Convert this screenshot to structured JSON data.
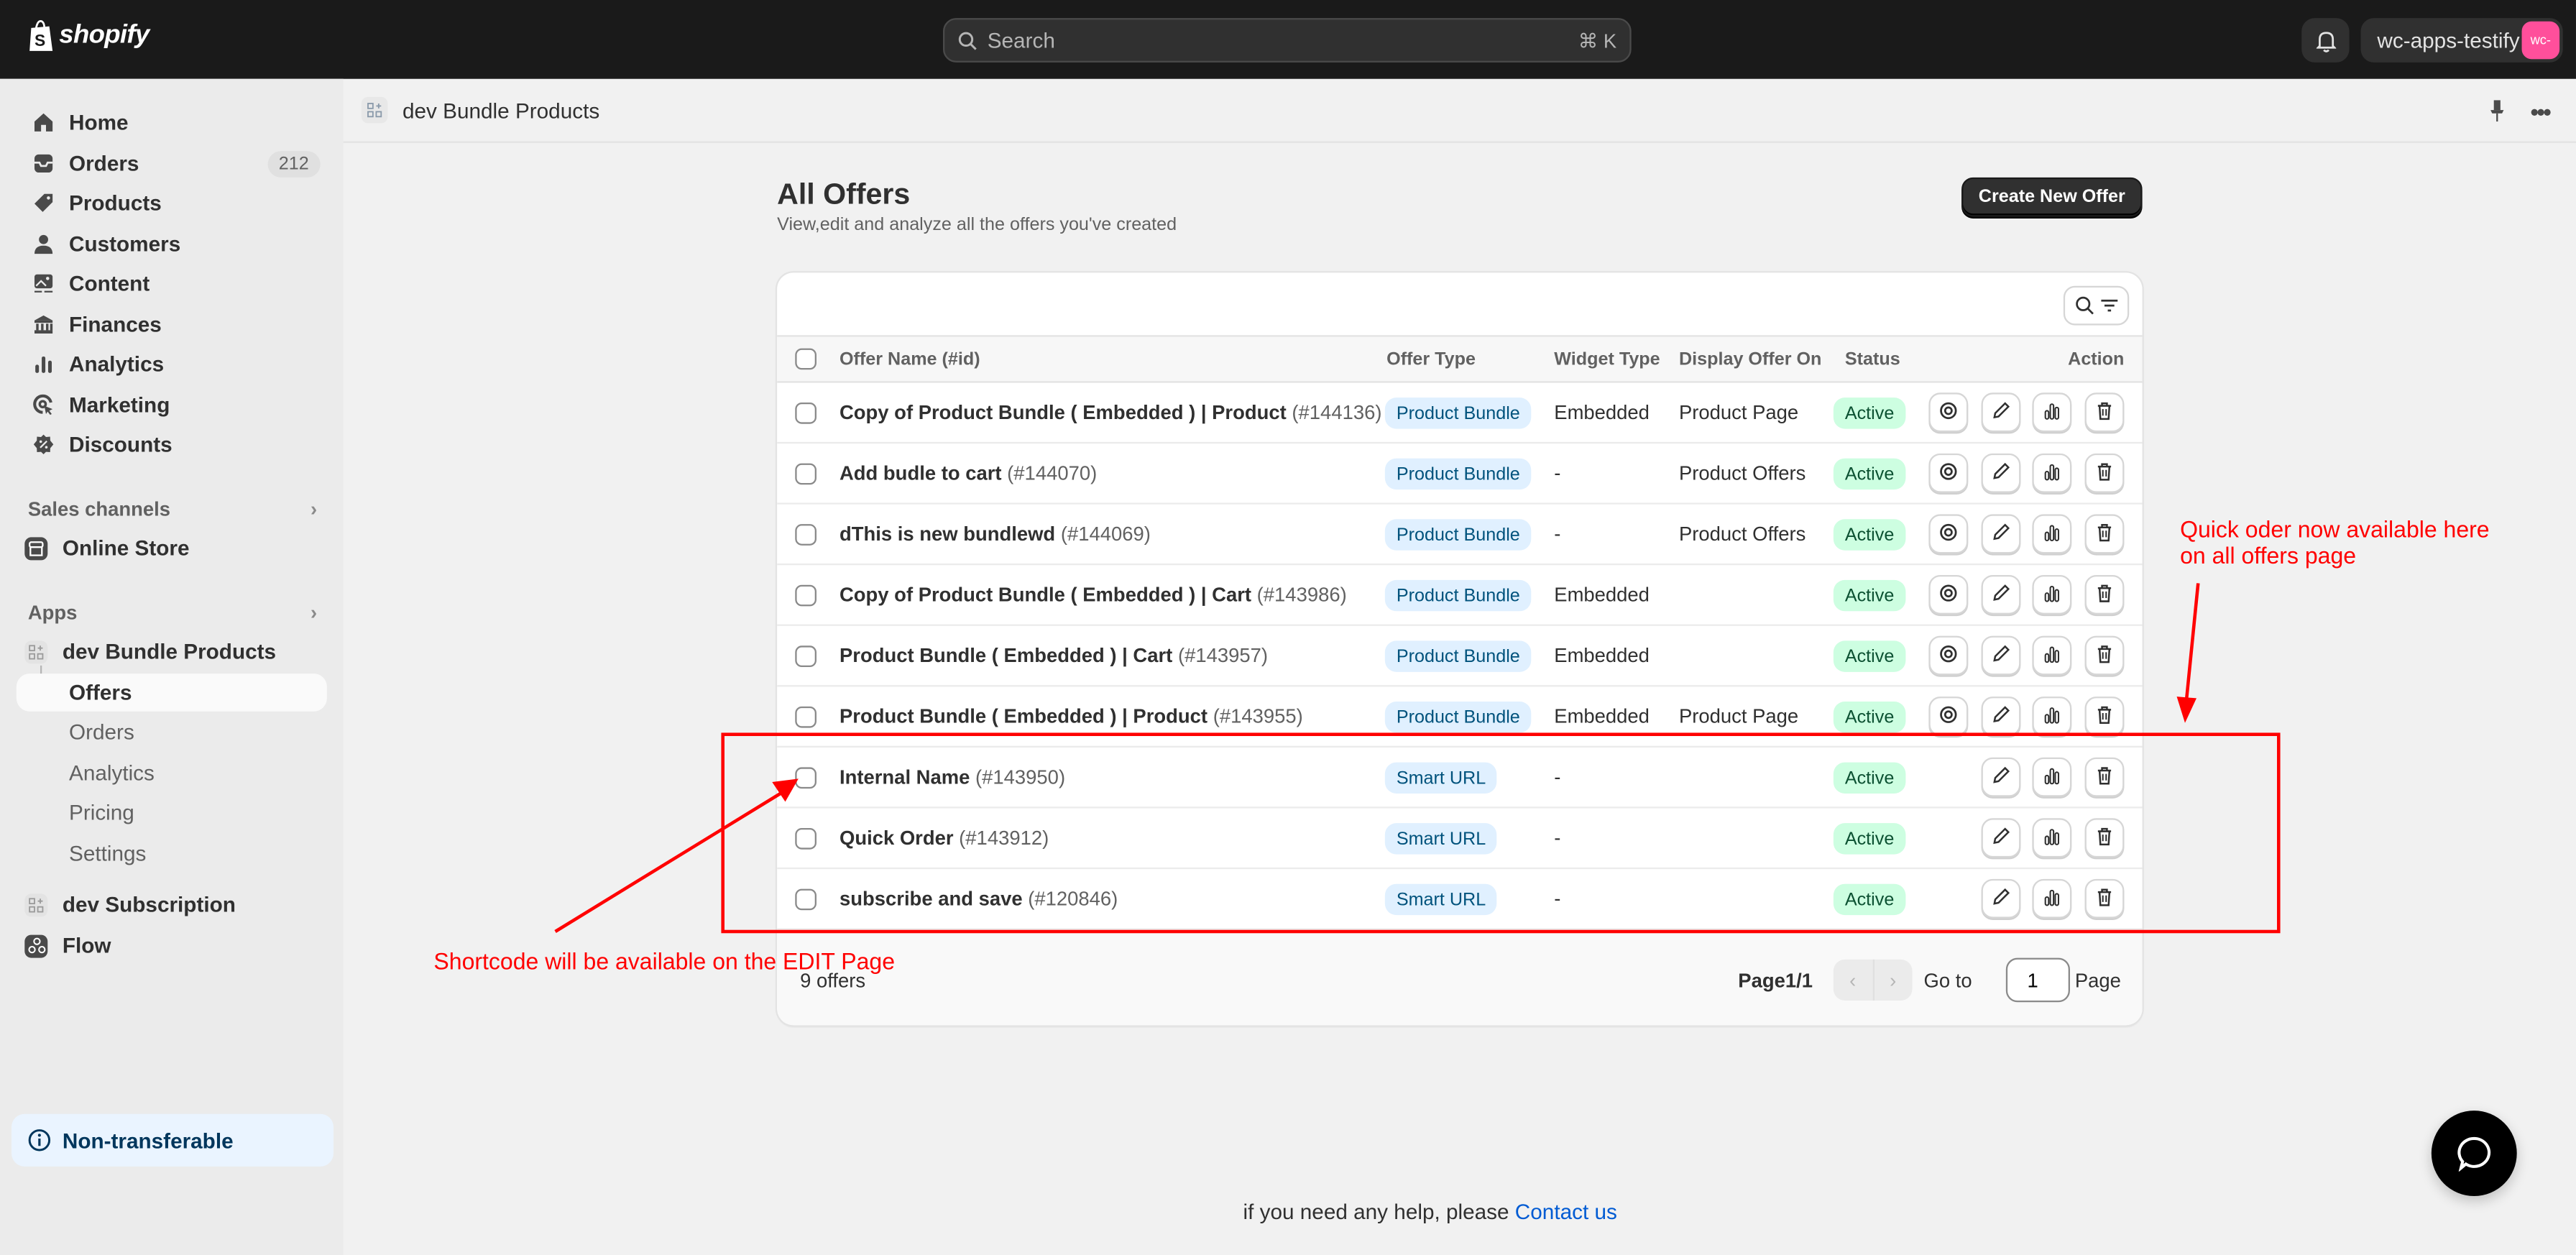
{
  "topbar": {
    "brand": "shopify",
    "search_placeholder": "Search",
    "search_shortcut": "⌘ K",
    "store_name": "wc-apps-testify",
    "store_avatar": "wc-"
  },
  "sidebar": {
    "main_items": [
      {
        "label": "Home",
        "icon": "home-icon"
      },
      {
        "label": "Orders",
        "icon": "orders-icon",
        "badge": "212"
      },
      {
        "label": "Products",
        "icon": "tag-icon"
      },
      {
        "label": "Customers",
        "icon": "person-icon"
      },
      {
        "label": "Content",
        "icon": "image-icon"
      },
      {
        "label": "Finances",
        "icon": "bank-icon"
      },
      {
        "label": "Analytics",
        "icon": "bar-chart-icon"
      },
      {
        "label": "Marketing",
        "icon": "target-icon"
      },
      {
        "label": "Discounts",
        "icon": "discount-icon"
      }
    ],
    "sales_channels_label": "Sales channels",
    "online_store": "Online Store",
    "apps_label": "Apps",
    "app1": "dev Bundle Products",
    "app1_sub": [
      "Offers",
      "Orders",
      "Analytics",
      "Pricing",
      "Settings"
    ],
    "app2": "dev Subscription",
    "app3": "Flow",
    "settings": "Settings",
    "non_transferable": "Non-transferable"
  },
  "appbar": {
    "title": "dev Bundle Products"
  },
  "page": {
    "title": "All Offers",
    "subtitle": "View,edit and analyze all the offers you've created",
    "create_button": "Create New Offer"
  },
  "table": {
    "headers": {
      "name": "Offer Name (#id)",
      "type": "Offer Type",
      "widget": "Widget Type",
      "display": "Display Offer On",
      "status": "Status",
      "action": "Action"
    },
    "rows": [
      {
        "name": "Copy of Product Bundle ( Embedded ) | Product",
        "id": "(#144136)",
        "type": "Product Bundle",
        "widget": "Embedded",
        "display": "Product Page",
        "status": "Active",
        "has_view": true
      },
      {
        "name": "Add budle to cart",
        "id": "(#144070)",
        "type": "Product Bundle",
        "widget": "-",
        "display": "Product Offers",
        "status": "Active",
        "has_view": true
      },
      {
        "name": "dThis is new bundlewd",
        "id": "(#144069)",
        "type": "Product Bundle",
        "widget": "-",
        "display": "Product Offers",
        "status": "Active",
        "has_view": true
      },
      {
        "name": "Copy of Product Bundle ( Embedded ) | Cart",
        "id": "(#143986)",
        "type": "Product Bundle",
        "widget": "Embedded",
        "display": "",
        "status": "Active",
        "has_view": true
      },
      {
        "name": "Product Bundle ( Embedded ) | Cart",
        "id": "(#143957)",
        "type": "Product Bundle",
        "widget": "Embedded",
        "display": "",
        "status": "Active",
        "has_view": true
      },
      {
        "name": "Product Bundle ( Embedded ) | Product",
        "id": "(#143955)",
        "type": "Product Bundle",
        "widget": "Embedded",
        "display": "Product Page",
        "status": "Active",
        "has_view": true
      },
      {
        "name": "Internal Name",
        "id": "(#143950)",
        "type": "Smart URL",
        "widget": "-",
        "display": "",
        "status": "Active",
        "has_view": false
      },
      {
        "name": "Quick Order",
        "id": "(#143912)",
        "type": "Smart URL",
        "widget": "-",
        "display": "",
        "status": "Active",
        "has_view": false
      },
      {
        "name": "subscribe and save",
        "id": "(#120846)",
        "type": "Smart URL",
        "widget": "-",
        "display": "",
        "status": "Active",
        "has_view": false
      }
    ],
    "footer": {
      "count": "9 offers",
      "page_info": "Page1/1",
      "prev": "‹",
      "next": "›",
      "goto_label": "Go to",
      "page_value": "1",
      "page_label": "Page"
    }
  },
  "help": {
    "text": "if you need any help, please ",
    "link": "Contact us"
  },
  "annotations": {
    "right_note": "Quick oder now available here\non all offers page",
    "left_note": "Shortcode will be available on the EDIT Page",
    "color": "#ff0000"
  },
  "colors": {
    "type_pill_bg": "#e0f0ff",
    "status_pill_bg": "#cdfee1",
    "brand_dark": "#1a1a1a",
    "link": "#005bd3"
  }
}
